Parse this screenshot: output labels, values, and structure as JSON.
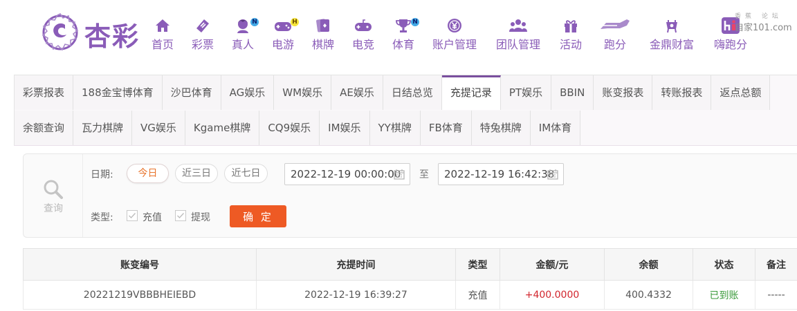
{
  "brand": {
    "name": "杏彩",
    "color": "#8a5cb8"
  },
  "nav": [
    {
      "label": "首页",
      "icon": "home-icon"
    },
    {
      "label": "彩票",
      "icon": "lottery-ticket-icon"
    },
    {
      "label": "真人",
      "icon": "live-dealer-icon",
      "badge": "N"
    },
    {
      "label": "电游",
      "icon": "gamepad-icon",
      "badge": "H"
    },
    {
      "label": "棋牌",
      "icon": "cards-icon"
    },
    {
      "label": "电竞",
      "icon": "esports-gamepad-icon"
    },
    {
      "label": "体育",
      "icon": "trophy-icon",
      "badge": "N"
    },
    {
      "label": "账户管理",
      "icon": "yen-coin-icon"
    },
    {
      "label": "团队管理",
      "icon": "team-icon"
    },
    {
      "label": "活动",
      "icon": "gift-icon"
    },
    {
      "label": "跑分",
      "icon": "running-icon"
    },
    {
      "label": "金鼎财富",
      "icon": "treasure-icon"
    },
    {
      "label": "嗨跑分",
      "icon": "hi-logo-icon"
    }
  ],
  "watermark": {
    "top": "香蕉 论坛",
    "bottom": "自家101.com"
  },
  "tabs": {
    "row1": [
      "彩票报表",
      "188金宝博体育",
      "沙巴体育",
      "AG娱乐",
      "WM娱乐",
      "AE娱乐",
      "日结总览",
      "充提记录",
      "PT娱乐",
      "BBIN",
      "账变报表",
      "转账报表",
      "返点总额"
    ],
    "row2": [
      "余额查询",
      "瓦力棋牌",
      "VG娱乐",
      "Kgame棋牌",
      "CQ9娱乐",
      "IM娱乐",
      "YY棋牌",
      "FB体育",
      "特兔棋牌",
      "IM体育"
    ],
    "active": "充提记录"
  },
  "filter": {
    "query_label": "查询",
    "date_label": "日期:",
    "quick_dates": [
      "今日",
      "近三日",
      "近七日"
    ],
    "active_quick": "今日",
    "start": "2022-12-19 00:00:00",
    "to": "至",
    "end": "2022-12-19 16:42:38",
    "type_label": "类型:",
    "types": [
      "充值",
      "提现"
    ],
    "confirm": "确 定"
  },
  "table": {
    "columns": [
      "账变编号",
      "充提时间",
      "类型",
      "金额/元",
      "余额",
      "状态",
      "备注"
    ],
    "rows": [
      [
        "20221219VBBBHEIEBD",
        "2022-12-19 16:39:27",
        "充值",
        "+400.0000",
        "400.4332",
        "已到账",
        "-----"
      ]
    ]
  },
  "colors": {
    "accent": "#8a5cb8",
    "tab_active": "#7a4f9e",
    "confirm": "#ee5a24",
    "amount": "#d2262e",
    "status_ok": "#3a9a3a",
    "highlight": "#e8742c"
  }
}
